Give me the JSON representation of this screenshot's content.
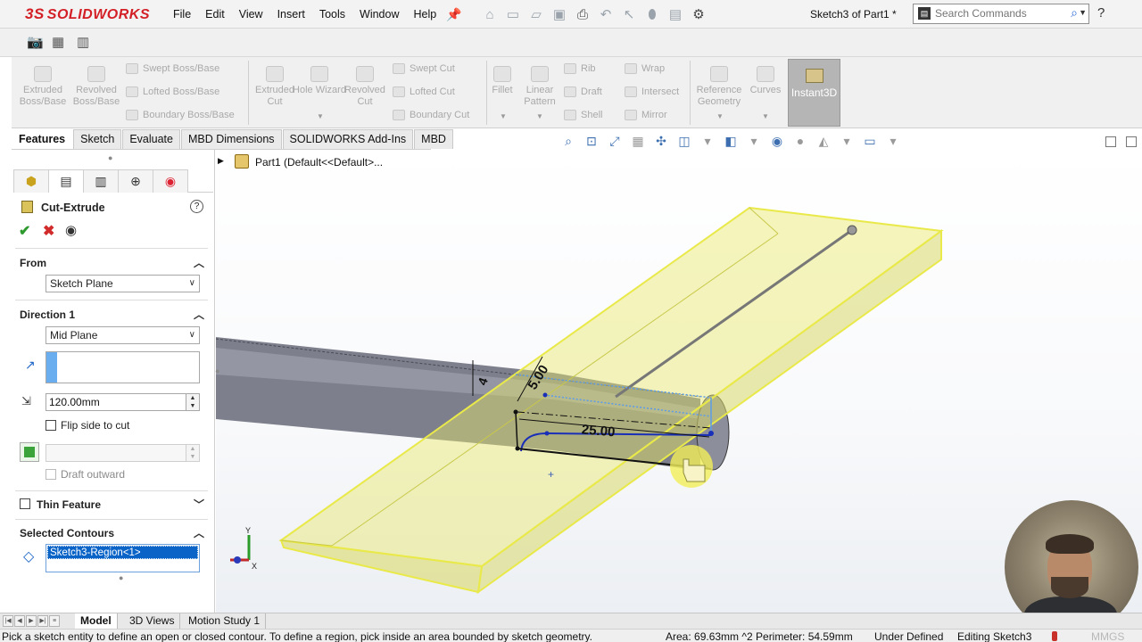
{
  "app": {
    "logo_ds": "3S",
    "logo_text": "SOLIDWORKS",
    "menu": [
      "File",
      "Edit",
      "View",
      "Insert",
      "Tools",
      "Window",
      "Help"
    ],
    "document_title": "Sketch3 of Part1 *",
    "search": {
      "placeholder": "Search Commands"
    }
  },
  "ribbon": {
    "extruded_boss": "Extruded Boss/Base",
    "revolved_boss": "Revolved Boss/Base",
    "swept_boss": "Swept Boss/Base",
    "lofted_boss": "Lofted Boss/Base",
    "boundary_boss": "Boundary Boss/Base",
    "extruded_cut": "Extruded Cut",
    "hole_wizard": "Hole Wizard",
    "revolved_cut": "Revolved Cut",
    "swept_cut": "Swept Cut",
    "lofted_cut": "Lofted Cut",
    "boundary_cut": "Boundary Cut",
    "fillet": "Fillet",
    "linear_pattern": "Linear Pattern",
    "rib": "Rib",
    "draft": "Draft",
    "shell": "Shell",
    "wrap": "Wrap",
    "intersect": "Intersect",
    "mirror": "Mirror",
    "reference_geometry": "Reference Geometry",
    "curves": "Curves",
    "instant3d": "Instant3D"
  },
  "tabs": [
    "Features",
    "Sketch",
    "Evaluate",
    "MBD Dimensions",
    "SOLIDWORKS Add-Ins",
    "MBD"
  ],
  "property_manager": {
    "title": "Cut-Extrude",
    "from": {
      "label": "From",
      "value": "Sketch Plane"
    },
    "direction1": {
      "label": "Direction 1",
      "end_condition": "Mid Plane",
      "depth": "120.00mm",
      "flip_side_label": "Flip side to cut",
      "draft_outward_label": "Draft outward"
    },
    "thin_feature": {
      "label": "Thin Feature"
    },
    "selected_contours": {
      "label": "Selected Contours",
      "items": [
        "Sketch3-Region<1>"
      ]
    }
  },
  "feature_tree": {
    "root": "Part1  (Default<<Default>..."
  },
  "viewport": {
    "dimensions": [
      "5.00",
      "25.00",
      "4"
    ],
    "triad": {
      "x": "X",
      "y": "Y"
    }
  },
  "bottom_tabs": [
    "Model",
    "3D Views",
    "Motion Study 1"
  ],
  "status": {
    "message": "Pick a sketch entity to define an open or closed contour. To define a region, pick inside an area bounded by sketch geometry.",
    "measure": "Area: 69.63mm ^2 Perimeter: 54.59mm",
    "sketch_state": "Under Defined",
    "editing": "Editing Sketch3",
    "units": "MMGS"
  },
  "colors": {
    "accent_red": "#d31f26",
    "highlight_yellow": "#e8e86a",
    "sketch_blue": "#1a2fb8",
    "selection_blue": "#0a64c8"
  }
}
